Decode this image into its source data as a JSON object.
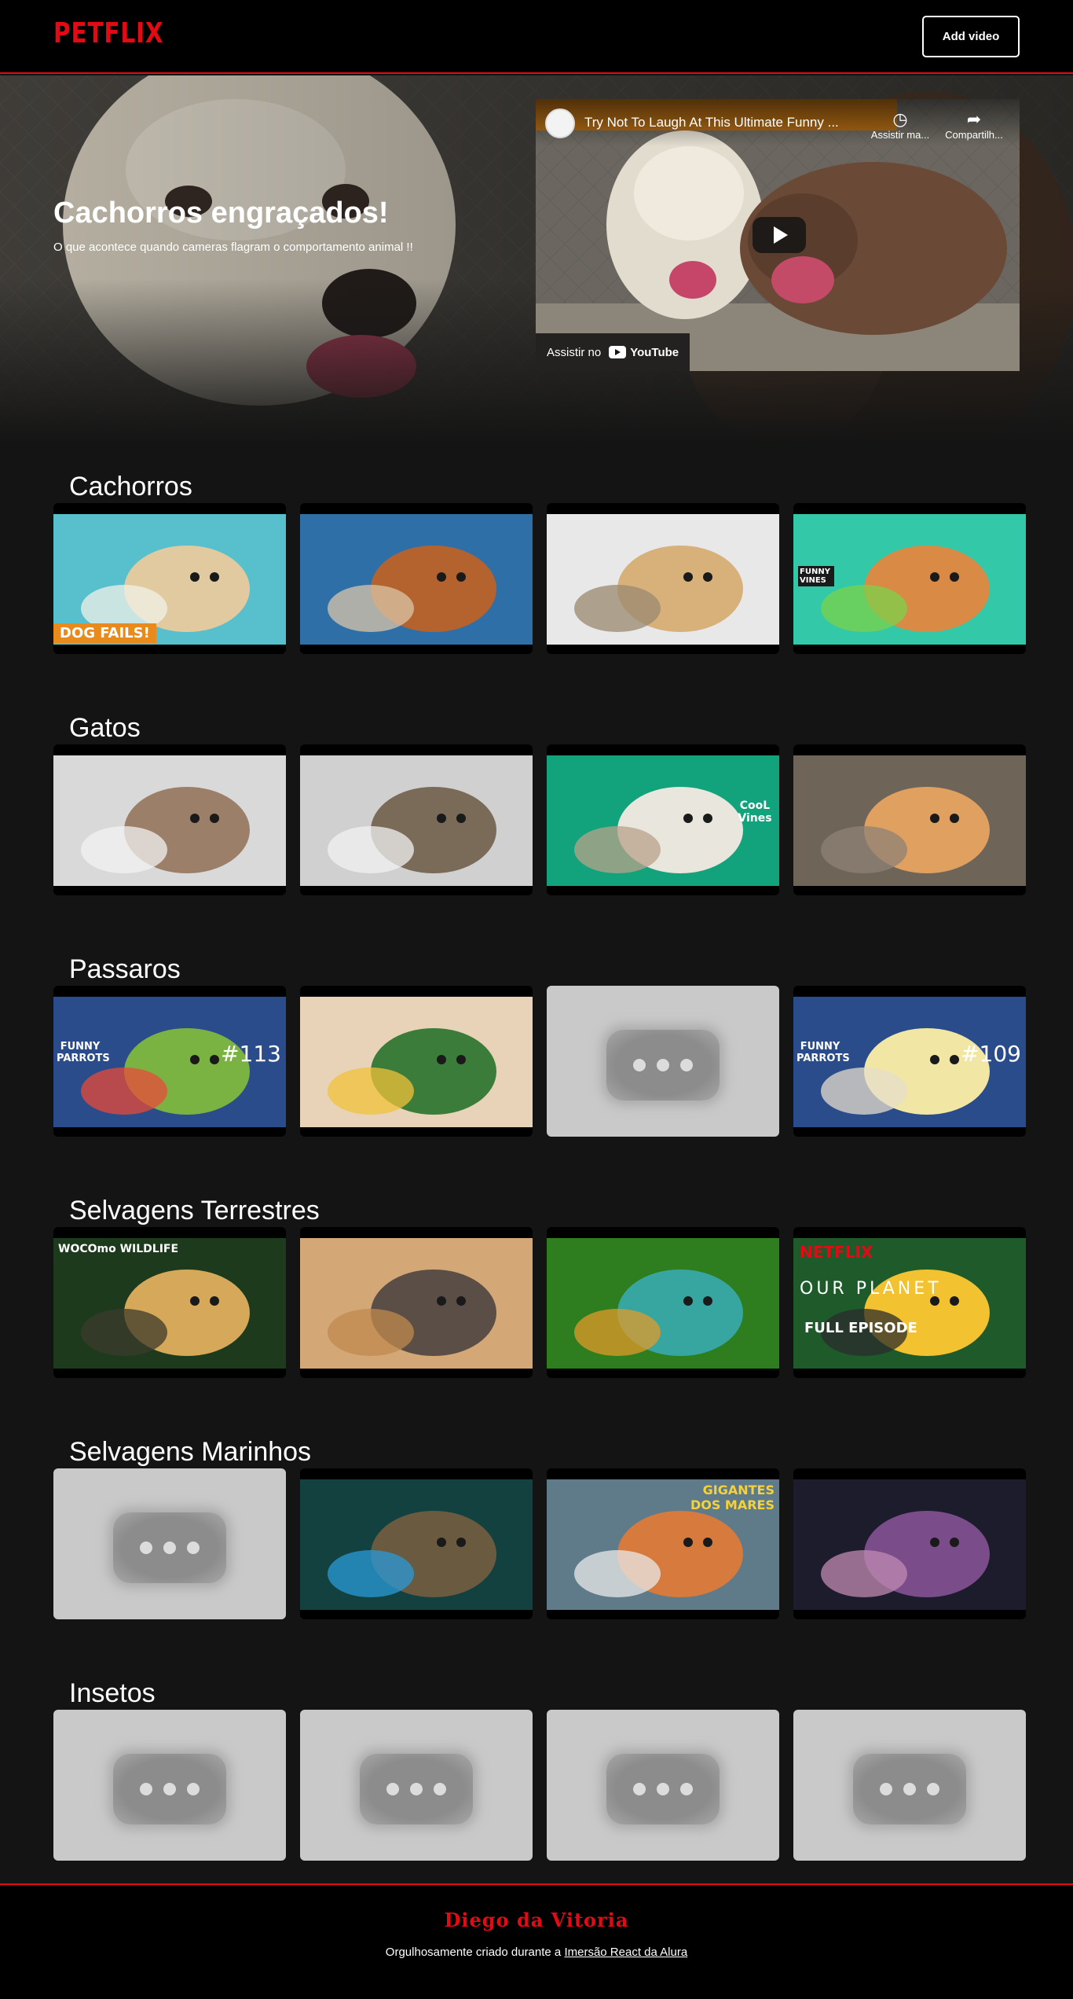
{
  "nav": {
    "logo": "PETFLIX",
    "add_button": "Add video"
  },
  "banner": {
    "title": "Cachorros engraçados!",
    "description": "O que acontece quando cameras flagram o comportamento animal !!",
    "player": {
      "video_title": "Try Not To Laugh At This Ultimate Funny ...",
      "watch_later": "Assistir ma...",
      "share": "Compartilh...",
      "watch_on": "Assistir no",
      "youtube": "YouTube"
    }
  },
  "categories": [
    {
      "title": "Cachorros",
      "videos": [
        {
          "thumb": "dog-pool",
          "caption": "DOG FAILS!"
        },
        {
          "thumb": "dachshund-fish"
        },
        {
          "thumb": "dog-washer"
        },
        {
          "thumb": "corgi-float",
          "caption": "FUNNY VINES"
        }
      ]
    },
    {
      "title": "Gatos",
      "videos": [
        {
          "thumb": "cat-jump"
        },
        {
          "thumb": "cat-sink"
        },
        {
          "thumb": "cat-toilet",
          "caption": "CooL Vines"
        },
        {
          "thumb": "cat-couch"
        }
      ]
    },
    {
      "title": "Passaros",
      "videos": [
        {
          "thumb": "parrot-sweater",
          "caption": "FUNNY PARROTS",
          "number": "#113"
        },
        {
          "thumb": "lovebirds"
        },
        {
          "thumb": "unavailable"
        },
        {
          "thumb": "cockatiel",
          "caption": "FUNNY PARROTS",
          "number": "#109"
        }
      ]
    },
    {
      "title": "Selvagens Terrestres",
      "videos": [
        {
          "thumb": "jaguar",
          "caption": "WOCOmo WILDLIFE"
        },
        {
          "thumb": "lion-boar"
        },
        {
          "thumb": "viper"
        },
        {
          "thumb": "hornbill",
          "brand": "NETFLIX",
          "caption": "OUR PLANET",
          "subcaption": "FULL EPISODE"
        }
      ]
    },
    {
      "title": "Selvagens Marinhos",
      "videos": [
        {
          "thumb": "unavailable"
        },
        {
          "thumb": "anglerfish"
        },
        {
          "thumb": "octopus",
          "caption": "GIGANTES DOS MARES"
        },
        {
          "thumb": "jellyfish"
        }
      ]
    },
    {
      "title": "Insetos",
      "videos": [
        {
          "thumb": "unavailable"
        },
        {
          "thumb": "unavailable"
        },
        {
          "thumb": "unavailable"
        },
        {
          "thumb": "unavailable"
        }
      ]
    }
  ],
  "footer": {
    "name": "Diego da Vitoria",
    "text": "Orgulhosamente criado durante a",
    "link": "Imersão React da Alura"
  },
  "colors": {
    "brand": "#e50914",
    "background": "#141414"
  }
}
